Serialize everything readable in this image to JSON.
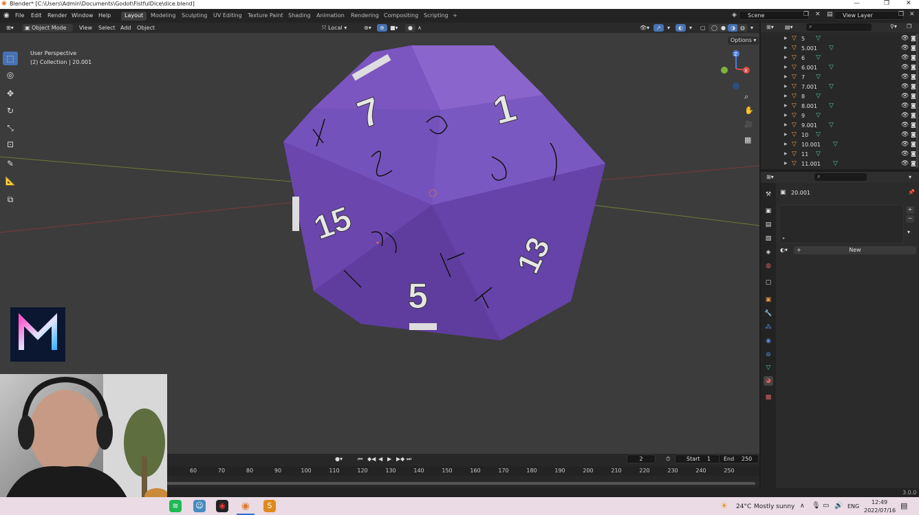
{
  "window": {
    "title": "Blender* [C:\\Users\\Admin\\Documents\\Godot\\FistfulDice\\dice.blend]"
  },
  "menu": [
    "File",
    "Edit",
    "Render",
    "Window",
    "Help"
  ],
  "workspaces": [
    "Layout",
    "Modeling",
    "Sculpting",
    "UV Editing",
    "Texture Paint",
    "Shading",
    "Animation",
    "Rendering",
    "Compositing",
    "Scripting",
    "+"
  ],
  "scene": "Scene",
  "view_layer": "View Layer",
  "viewport_header": {
    "mode": "Object Mode",
    "menus": [
      "View",
      "Select",
      "Add",
      "Object"
    ],
    "orientation": "Local",
    "options": "Options"
  },
  "viewport": {
    "perspective": "User Perspective",
    "collection": "(2) Collection | 20.001"
  },
  "outliner": {
    "rows": [
      {
        "name": "5"
      },
      {
        "name": "5.001"
      },
      {
        "name": "6"
      },
      {
        "name": "6.001"
      },
      {
        "name": "7"
      },
      {
        "name": "7.001"
      },
      {
        "name": "8"
      },
      {
        "name": "8.001"
      },
      {
        "name": "9"
      },
      {
        "name": "9.001"
      },
      {
        "name": "10"
      },
      {
        "name": "10.001"
      },
      {
        "name": "11"
      },
      {
        "name": "11.001"
      }
    ]
  },
  "properties": {
    "object_name": "20.001",
    "new_button": "New"
  },
  "timeline": {
    "current_frame": "2",
    "start_label": "Start",
    "start": "1",
    "end_label": "End",
    "end": "250",
    "ticks": [
      "60",
      "70",
      "80",
      "90",
      "100",
      "110",
      "120",
      "130",
      "140",
      "150",
      "160",
      "170",
      "180",
      "190",
      "200",
      "210",
      "220",
      "230",
      "240",
      "250"
    ]
  },
  "version": "3.0.0",
  "taskbar": {
    "weather": "24°C",
    "weather_desc": "Mostly sunny",
    "lang": "ENG",
    "time": "12:49",
    "date": "2022/07/16"
  },
  "dice_faces": [
    "7",
    "1",
    "15",
    "13",
    "5"
  ],
  "colors": {
    "accent": "#4772b3",
    "die": "#7a4fbf",
    "viewport_bg": "#3c3c3c"
  }
}
